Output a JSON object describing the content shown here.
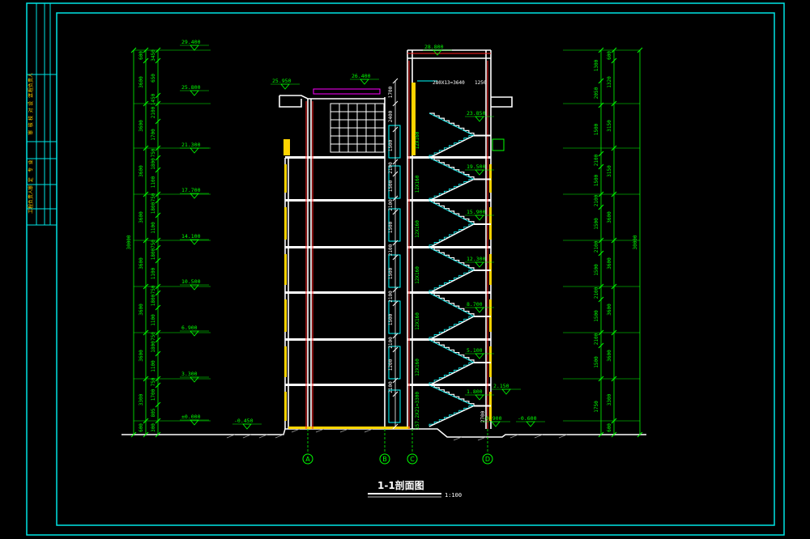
{
  "colors": {
    "frame": "#00e5e5",
    "dim": "#00ff00",
    "wall": "#ffffff",
    "red": "#ff2020",
    "yellow": "#ffd400",
    "cyan": "#00ffff",
    "magenta": "#ff00ff",
    "grey": "#9a9a9a"
  },
  "title_block": {
    "left_group": [
      "工程负责人",
      "设 计",
      "校 对",
      "审 核"
    ],
    "mid_group": [
      "专 业",
      "审 定",
      "工程负责人"
    ]
  },
  "drawing_title": "1-1剖面图",
  "scale": "1:100",
  "axis_labels": [
    "A",
    "B",
    "C",
    "D"
  ],
  "levels_left": [
    "29.400",
    "25.800",
    "21.300",
    "17.700",
    "14.100",
    "10.500",
    "6.900",
    "3.300",
    "±0.000"
  ],
  "levels_stair": [
    "23.850",
    "19.500",
    "15.900",
    "12.300",
    "8.700",
    "5.100",
    "1.800"
  ],
  "levels_misc": {
    "roof_top": "28.800",
    "parapet_left": "25.950",
    "parapet_mid": "26.400",
    "ground_left": "-0.450",
    "ground_right1": "-0.900",
    "ground_right2": "-0.600",
    "canopy": "2.150"
  },
  "stair_note": "280X13=3640",
  "stair_note2": "1250",
  "total_left": "30000",
  "total_right": "30000",
  "dims_left_outer": [
    "600",
    "3600",
    "3600",
    "3600",
    "3600",
    "3600",
    "3600",
    "3600",
    "3300",
    "600"
  ],
  "dims_left_inner": [
    "3450",
    "650",
    "1450",
    "2100",
    "1700",
    "750",
    "1800",
    "1100",
    "750",
    "1800",
    "1100",
    "750",
    "1800",
    "1100",
    "750",
    "1800",
    "1100",
    "750",
    "1800",
    "1100",
    "750",
    "1700",
    "805",
    "300"
  ],
  "dims_right_outer": [
    "600",
    "1320",
    "3150",
    "3150",
    "3600",
    "3600",
    "3600",
    "3600",
    "3300",
    "600"
  ],
  "dims_right_inner": [
    "1300",
    "2050",
    "1500",
    "2100",
    "1500",
    "2100",
    "1500",
    "2100",
    "1500",
    "2100",
    "1500",
    "2100",
    "1500",
    "1750"
  ],
  "flight_notes": [
    "12X160",
    "12X160",
    "12X160",
    "12X160",
    "12X160",
    "12X160",
    "157.2X21=3300"
  ],
  "window_dims": [
    "1700",
    "2400",
    "1500",
    "2100",
    "1500",
    "2100",
    "1500",
    "2100",
    "1500",
    "2100",
    "1500",
    "2100",
    "1200",
    "2100"
  ],
  "bottom_dim": "2700"
}
